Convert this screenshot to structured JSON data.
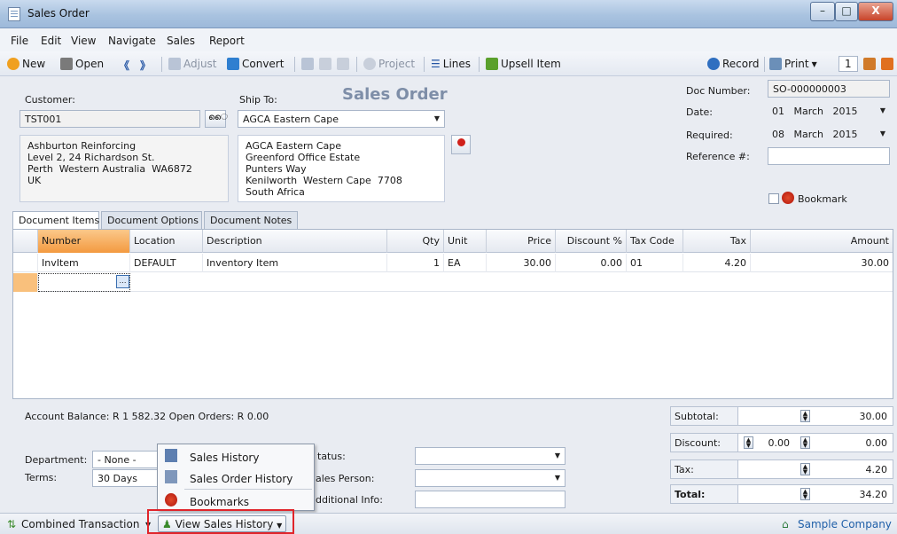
{
  "window": {
    "title": "Sales Order",
    "min": "–",
    "max": "□",
    "close": "X"
  },
  "menu": [
    "File",
    "Edit",
    "View",
    "Navigate",
    "Sales",
    "Report"
  ],
  "toolbar": {
    "new": "New",
    "open": "Open",
    "prev": "《",
    "next": "》",
    "adjust": "Adjust",
    "convert": "Convert",
    "project": "Project",
    "lines": "Lines",
    "upsell": "Upsell Item",
    "record": "Record",
    "print": "Print",
    "copies": "1"
  },
  "form": {
    "heading": "Sales Order",
    "customer_label": "Customer:",
    "customer_value": "TST001",
    "shipto_label": "Ship To:",
    "shipto_value": "AGCA Eastern Cape",
    "bill_address": "Ashburton Reinforcing\nLevel 2, 24 Richardson St.\nPerth  Western Australia  WA6872\nUK",
    "ship_address": "AGCA Eastern Cape\nGreenford Office Estate\nPunters Way\nKenilworth  Western Cape  7708\nSouth Africa",
    "docnum_label": "Doc Number:",
    "docnum_value": "SO-000000003",
    "date_label": "Date:",
    "date_day": "01",
    "date_month": "March",
    "date_year": "2015",
    "required_label": "Required:",
    "req_day": "08",
    "req_month": "March",
    "req_year": "2015",
    "ref_label": "Reference #:",
    "ref_value": "",
    "bookmark": "Bookmark"
  },
  "tabs": [
    "Document Items",
    "Document Options",
    "Document Notes"
  ],
  "grid": {
    "headers": [
      "Number",
      "Location",
      "Description",
      "Qty",
      "Unit",
      "Price",
      "Discount %",
      "Tax Code",
      "Tax",
      "Amount"
    ],
    "rows": [
      [
        "InvItem",
        "DEFAULT",
        "Inventory Item",
        "1",
        "EA",
        "30.00",
        "0.00",
        "01",
        "4.20",
        "30.00"
      ]
    ]
  },
  "bottom": {
    "account_balance": "Account Balance: R 1 582.32  Open Orders: R 0.00",
    "department_label": "Department:",
    "department_value": "- None -",
    "terms_label": "Terms:",
    "terms_value": "30 Days From",
    "status_label": "tatus:",
    "salesperson_label": "ales Person:",
    "additional_label": "dditional Info:"
  },
  "totals": {
    "subtotal_label": "Subtotal:",
    "subtotal": "30.00",
    "discount_label": "Discount:",
    "discount_pct": "0.00",
    "discount": "0.00",
    "tax_label": "Tax:",
    "tax": "4.20",
    "total_label": "Total:",
    "total": "34.20"
  },
  "popup": [
    "Sales History",
    "Sales Order History",
    "Bookmarks"
  ],
  "status": {
    "combined": "Combined Transaction",
    "history": "View Sales History",
    "company": "Sample Company"
  }
}
